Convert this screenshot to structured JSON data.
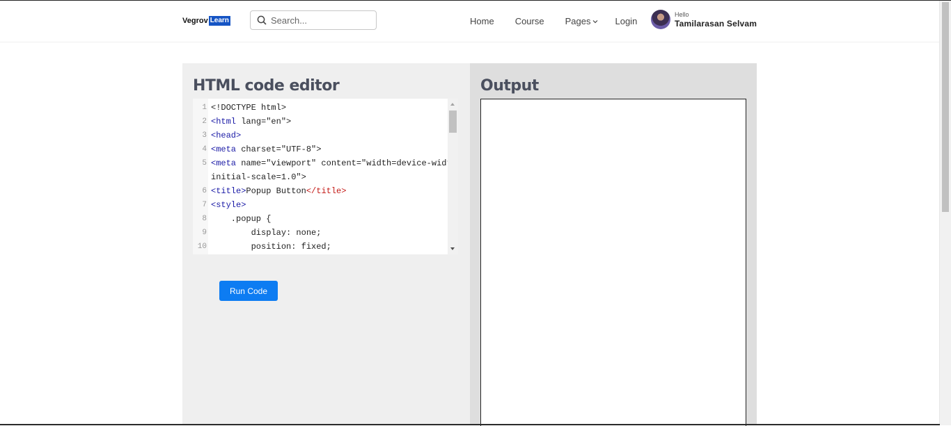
{
  "header": {
    "logo_text": "Vegrov",
    "logo_badge": "Learn",
    "search_placeholder": "Search...",
    "nav": [
      "Home",
      "Course",
      "Pages",
      "Login"
    ],
    "user": {
      "greeting": "Hello",
      "name": "Tamilarasan Selvam"
    }
  },
  "editor": {
    "title": "HTML code editor",
    "lines": [
      {
        "num": "1",
        "parts": [
          {
            "t": "<!DOCTYPE html>",
            "c": ""
          }
        ]
      },
      {
        "num": "2",
        "parts": [
          {
            "t": "<html",
            "c": "tag"
          },
          {
            "t": " lang=\"en\">",
            "c": ""
          }
        ]
      },
      {
        "num": "3",
        "parts": [
          {
            "t": "<head>",
            "c": "tag"
          }
        ]
      },
      {
        "num": "4",
        "parts": [
          {
            "t": "<meta",
            "c": "tag"
          },
          {
            "t": " charset=\"UTF-8\">",
            "c": ""
          }
        ]
      },
      {
        "num": "5",
        "parts": [
          {
            "t": "<meta",
            "c": "tag"
          },
          {
            "t": " name=\"viewport\" content=\"width=device-width,",
            "c": ""
          }
        ]
      },
      {
        "num": "",
        "parts": [
          {
            "t": "initial-scale=1.0\">",
            "c": ""
          }
        ]
      },
      {
        "num": "6",
        "parts": [
          {
            "t": "<title>",
            "c": "tag"
          },
          {
            "t": "Popup Button",
            "c": ""
          },
          {
            "t": "</title>",
            "c": "ctag"
          }
        ]
      },
      {
        "num": "7",
        "parts": [
          {
            "t": "<style>",
            "c": "tag"
          }
        ]
      },
      {
        "num": "8",
        "parts": [
          {
            "t": "    .popup {",
            "c": ""
          }
        ]
      },
      {
        "num": "9",
        "parts": [
          {
            "t": "        display: none;",
            "c": ""
          }
        ]
      },
      {
        "num": "10",
        "parts": [
          {
            "t": "        position: fixed;",
            "c": ""
          }
        ]
      }
    ],
    "run_label": "Run Code"
  },
  "output": {
    "title": "Output"
  }
}
